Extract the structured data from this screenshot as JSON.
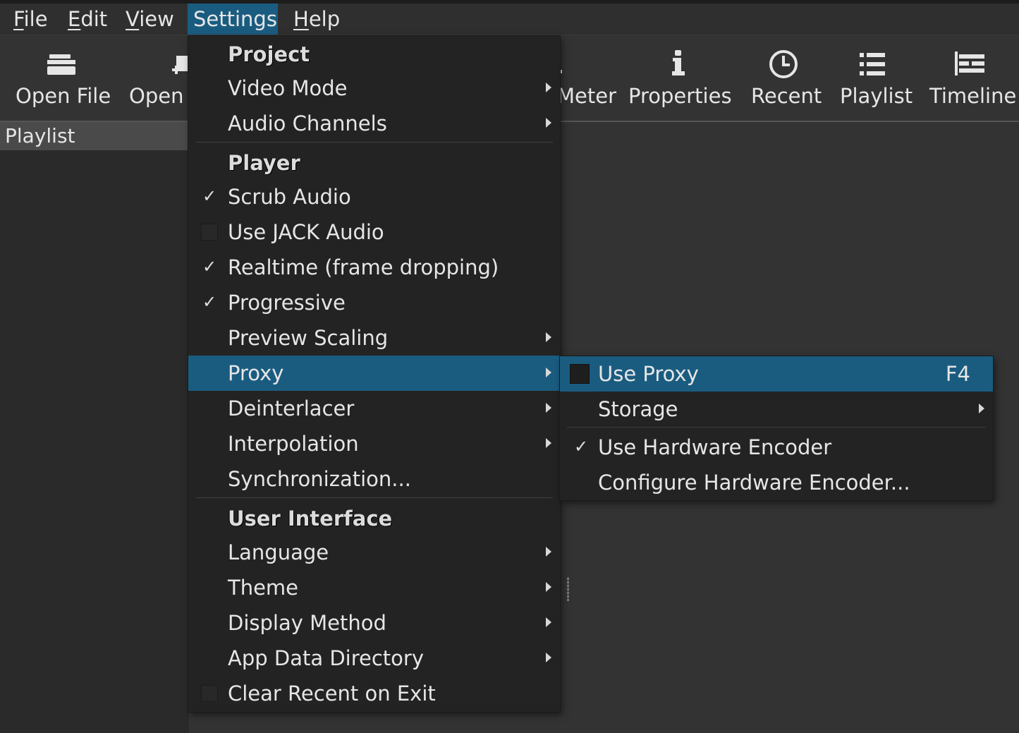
{
  "menubar": {
    "items": [
      {
        "underline": "F",
        "rest": "ile"
      },
      {
        "underline": "E",
        "rest": "dit"
      },
      {
        "underline": "V",
        "rest": "iew"
      },
      {
        "underline": "",
        "rest": "Settings"
      },
      {
        "underline": "H",
        "rest": "elp"
      }
    ]
  },
  "toolbar": {
    "open_file": "Open File",
    "open_other": "Open",
    "peak_meter": "Meter",
    "properties": "Properties",
    "recent": "Recent",
    "playlist": "Playlist",
    "timeline": "Timeline"
  },
  "dock": {
    "title": "Playlist"
  },
  "settings_menu": {
    "project_header": "Project",
    "video_mode": "Video Mode",
    "audio_channels": "Audio Channels",
    "player_header": "Player",
    "scrub_audio": "Scrub Audio",
    "use_jack_audio": "Use JACK Audio",
    "realtime": "Realtime (frame dropping)",
    "progressive": "Progressive",
    "preview_scaling": "Preview Scaling",
    "proxy": "Proxy",
    "deinterlacer": "Deinterlacer",
    "interpolation": "Interpolation",
    "synchronization": "Synchronization...",
    "ui_header": "User Interface",
    "language": "Language",
    "theme": "Theme",
    "display_method": "Display Method",
    "app_data_directory": "App Data Directory",
    "clear_recent": "Clear Recent on Exit",
    "checked": {
      "scrub_audio": true,
      "use_jack_audio": false,
      "realtime": true,
      "progressive": true,
      "clear_recent": false
    }
  },
  "proxy_menu": {
    "use_proxy": "Use Proxy",
    "use_proxy_shortcut": "F4",
    "storage": "Storage",
    "use_hw_encoder": "Use Hardware Encoder",
    "configure_hw_encoder": "Configure Hardware Encoder...",
    "checked": {
      "use_proxy": false,
      "use_hw_encoder": true
    }
  },
  "check_glyph": "✓",
  "colors": {
    "highlight": "#1a5c80",
    "background": "#333333",
    "menu": "#232323"
  }
}
